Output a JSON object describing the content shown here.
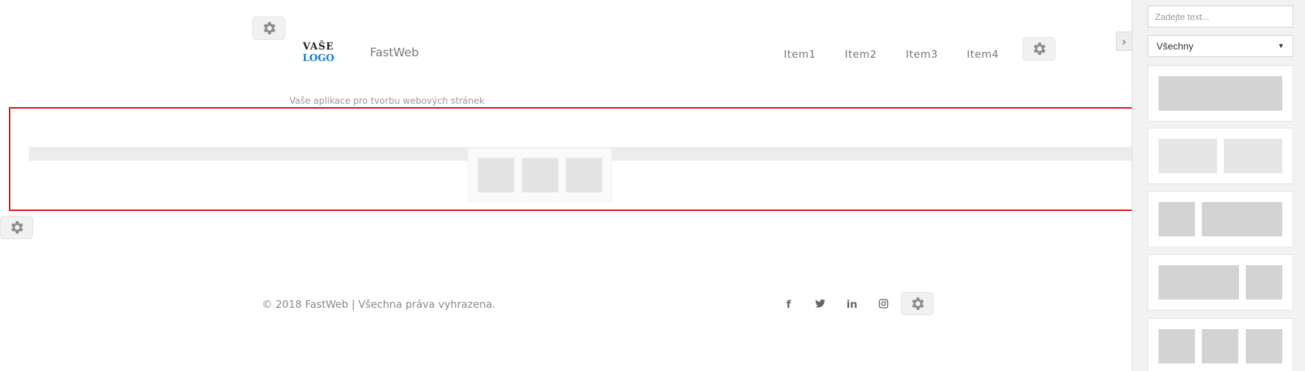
{
  "header": {
    "logo_line1": "VAŠE",
    "logo_line2": "LOGO",
    "brand": "FastWeb",
    "nav_items": [
      "Item1",
      "Item2",
      "Item3",
      "Item4"
    ],
    "tagline": "Vaše aplikace pro tvorbu webových stránek"
  },
  "footer": {
    "copyright": "© 2018 FastWeb | Všechna práva vyhrazena.",
    "social": [
      "facebook-icon",
      "twitter-icon",
      "linkedin-icon",
      "instagram-icon"
    ]
  },
  "sidebar": {
    "search_placeholder": "Zadejte text...",
    "filter_selected": "Všechny",
    "toggle_icon": "chevron-right-icon",
    "layout_cards": [
      "one-column",
      "two-equal-columns",
      "narrow-wide",
      "wide-narrow",
      "three-columns"
    ]
  },
  "colors": {
    "selection_border": "#e00000",
    "logo_blue": "#1d7fc9",
    "placeholder_block": "#d3d3d3"
  }
}
